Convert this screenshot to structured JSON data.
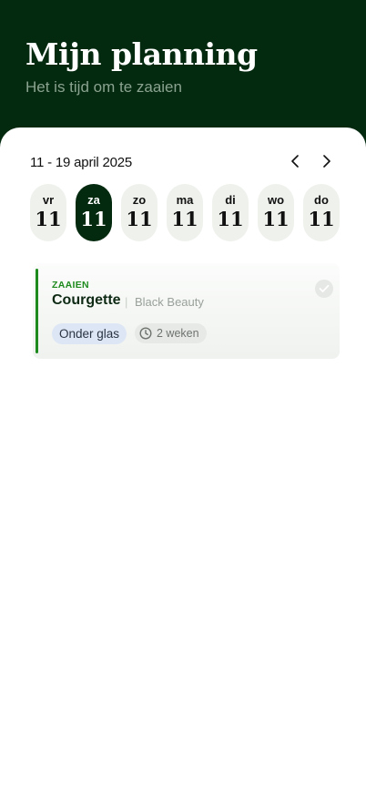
{
  "header": {
    "title": "Mijn planning",
    "subtitle": "Het is tijd om te zaaien"
  },
  "week": {
    "range": "11 - 19 april 2025",
    "prev_icon": "chevron-left-icon",
    "next_icon": "chevron-right-icon",
    "days": [
      {
        "name": "vr",
        "num": "11",
        "active": false
      },
      {
        "name": "za",
        "num": "11",
        "active": true
      },
      {
        "name": "zo",
        "num": "11",
        "active": false
      },
      {
        "name": "ma",
        "num": "11",
        "active": false
      },
      {
        "name": "di",
        "num": "11",
        "active": false
      },
      {
        "name": "wo",
        "num": "11",
        "active": false
      },
      {
        "name": "do",
        "num": "11",
        "active": false
      }
    ]
  },
  "task": {
    "label": "ZAAIEN",
    "name": "Courgette",
    "separator": "|",
    "variety": "Black Beauty",
    "location": "Onder glas",
    "duration": "2 weken",
    "duration_icon": "clock-icon",
    "check_icon": "check-icon"
  },
  "colors": {
    "header_bg": "#03290f",
    "accent_green": "#1e8a1e",
    "day_pill_bg": "#eef1ec",
    "chip_blue_bg": "#dde6f5"
  }
}
